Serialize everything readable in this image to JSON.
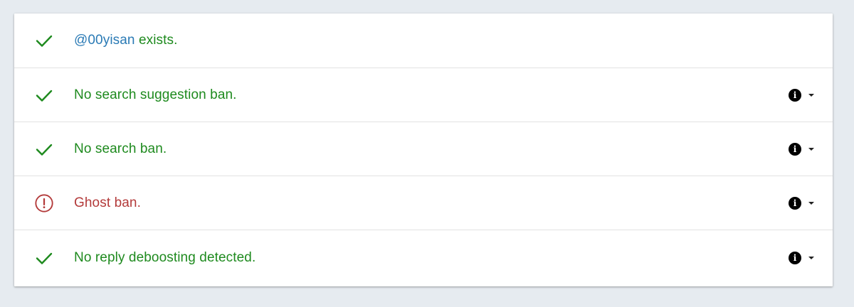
{
  "colors": {
    "page_bg": "#e6ebf0",
    "ok": "#1e8a1e",
    "bad": "#b33a3a",
    "handle": "#2a7ab5"
  },
  "results": [
    {
      "status": "ok",
      "icon": "check-icon",
      "handle": "@00yisan",
      "text": " exists.",
      "has_info": false
    },
    {
      "status": "ok",
      "icon": "check-icon",
      "text": "No search suggestion ban.",
      "has_info": true
    },
    {
      "status": "ok",
      "icon": "check-icon",
      "text": "No search ban.",
      "has_info": true
    },
    {
      "status": "bad",
      "icon": "alert-circle-icon",
      "text": "Ghost ban.",
      "has_info": true
    },
    {
      "status": "ok",
      "icon": "check-icon",
      "text": "No reply deboosting detected.",
      "has_info": true
    }
  ]
}
